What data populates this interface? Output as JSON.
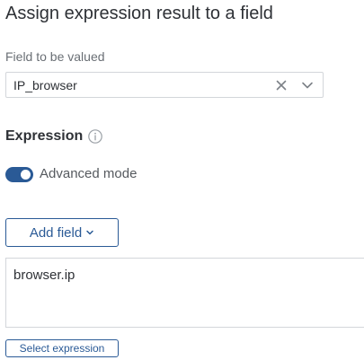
{
  "title": "Assign expression result to a field",
  "field": {
    "label": "Field to be valued",
    "value": "IP_browser",
    "icons": [
      "close-icon",
      "chevron-down-icon"
    ]
  },
  "expression": {
    "heading": "Expression",
    "info_icon": "info-icon",
    "advanced_mode": {
      "label": "Advanced mode",
      "enabled": true
    },
    "add_field_label": "Add field",
    "value": "browser.ip",
    "select_label": "Select expression"
  },
  "colors": {
    "accent": "#2a5a96",
    "border": "#d3d6da",
    "text": "#2e3136",
    "muted": "#6a6f75"
  }
}
